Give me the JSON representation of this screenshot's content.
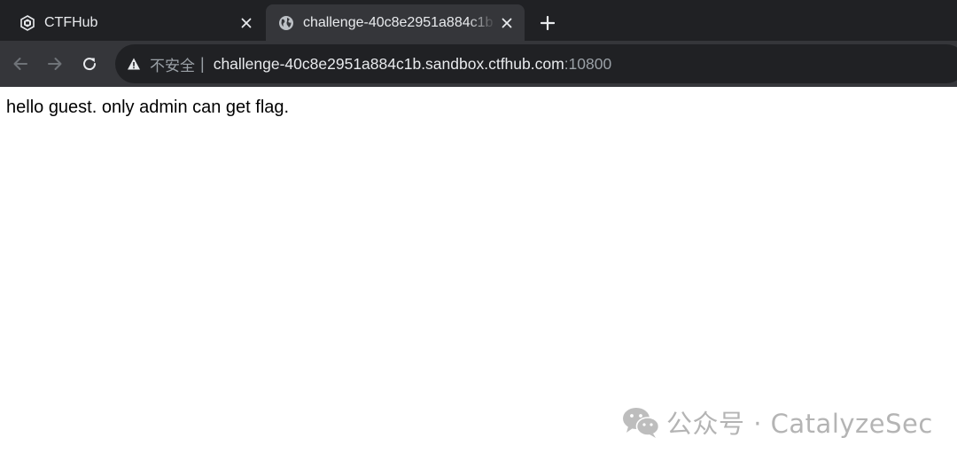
{
  "browser": {
    "tabs": [
      {
        "title": "CTFHub",
        "icon": "ctfhub-logo-icon",
        "active": false
      },
      {
        "title": "challenge-40c8e2951a884c1b",
        "icon": "globe-icon",
        "active": true
      }
    ],
    "address_bar": {
      "security_label": "不安全",
      "separator": "|",
      "host": "challenge-40c8e2951a884c1b.sandbox.ctfhub.com",
      "port": ":10800"
    }
  },
  "page": {
    "message": "hello guest. only admin can get flag."
  },
  "watermark": {
    "text": "公众号 · CatalyzeSec",
    "icon": "wechat-icon"
  },
  "colors": {
    "tabstrip_bg": "#202124",
    "toolbar_bg": "#35363a",
    "omnibox_bg": "#202124",
    "text_light": "#e8eaed",
    "text_muted": "#9aa0a6"
  }
}
